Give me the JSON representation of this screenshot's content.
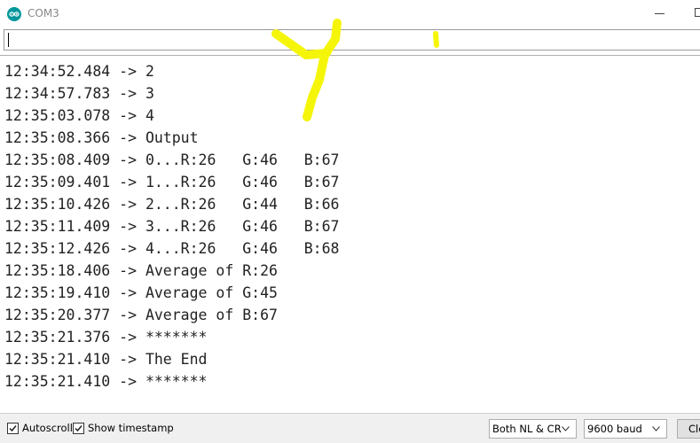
{
  "window": {
    "title": "COM3"
  },
  "send": {
    "value": ""
  },
  "output": {
    "lines": [
      "12:34:52.484 -> 2",
      "12:34:57.783 -> 3",
      "12:35:03.078 -> 4",
      "12:35:08.366 -> Output",
      "12:35:08.409 -> 0...R:26   G:46   B:67",
      "12:35:09.401 -> 1...R:26   G:46   B:67",
      "12:35:10.426 -> 2...R:26   G:44   B:66",
      "12:35:11.409 -> 3...R:26   G:46   B:67",
      "12:35:12.426 -> 4...R:26   G:46   B:68",
      "12:35:18.406 -> Average of R:26",
      "12:35:19.410 -> Average of G:45",
      "12:35:20.377 -> Average of B:67",
      "12:35:21.376 -> *******",
      "12:35:21.410 -> The End",
      "12:35:21.410 -> *******"
    ]
  },
  "bottombar": {
    "autoscroll_label": "Autoscroll",
    "autoscroll_checked": true,
    "timestamp_label": "Show timestamp",
    "timestamp_checked": true,
    "line_ending": "Both NL & CR",
    "baud_rate": "9600 baud",
    "clear_label": "Clear output"
  },
  "colors": {
    "highlighter": "#f5f50a",
    "text": "#222222",
    "app_icon": "#00979c"
  },
  "icons": {
    "app": "arduino-icon",
    "minimize": "minimize-icon",
    "maximize": "maximize-icon",
    "dropdown": "chevron-down-icon",
    "checkbox": "checkmark-icon"
  }
}
